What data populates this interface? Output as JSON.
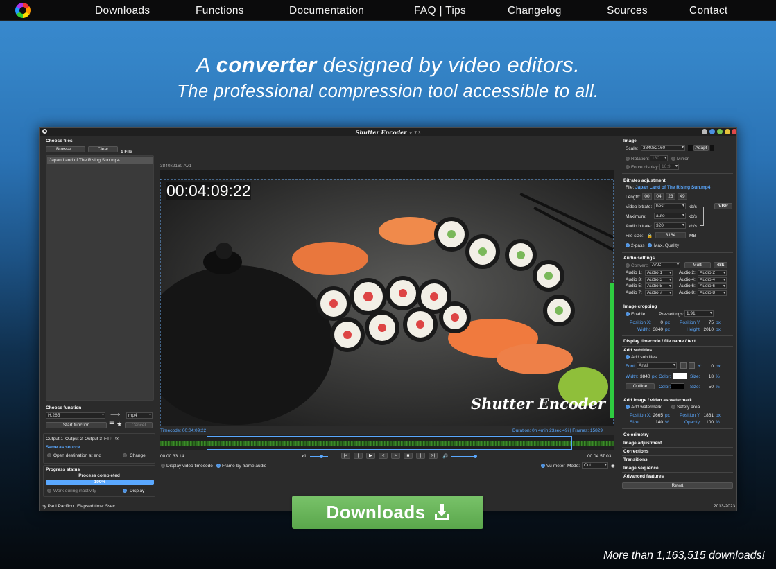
{
  "nav": {
    "items": [
      "Downloads",
      "Functions",
      "Documentation",
      "FAQ | Tips",
      "Changelog",
      "Sources",
      "Contact"
    ]
  },
  "hero": {
    "line1_pre": "A ",
    "line1_bold": "converter",
    "line1_post": " designed by video editors.",
    "line2": "The professional compression tool accessible to all."
  },
  "app": {
    "title": "Shutter Encoder",
    "version": "v17.3",
    "left": {
      "choose_files": "Choose files",
      "browse": "Browse...",
      "clear": "Clear",
      "file_count": "1 File",
      "file_item": "Japan Land of The Rising Sun.mp4",
      "choose_function": "Choose function",
      "codec": "H.265",
      "container": "mp4",
      "start": "Start function",
      "cancel": "Cancel",
      "outputs": [
        "Output 1",
        "Output 2",
        "Output 3",
        "FTP"
      ],
      "same_as_source": "Same as source",
      "open_dest": "Open destination at end",
      "change": "Change",
      "progress_status": "Progress status",
      "process_completed": "Process completed",
      "progress_text": "100%",
      "progress_value": 1.0,
      "work_inactivity": "Work during inactivity",
      "display": "Display",
      "author": "by Paul Pacifico",
      "elapsed": "Elapsed time: 5sec"
    },
    "center": {
      "resolution": "3840x2160 AV1",
      "overlay_tc": "00:04:09:22",
      "watermark": "Shutter Encoder",
      "timecode_label": "Timecode: 00:04:09:22",
      "duration_label": "Duration: 0h 4min 23sec 49i | Frames: 15829",
      "tc_in": "00 00 33 14",
      "tc_out": "00 04 57 03",
      "speed": "x1",
      "transport": [
        "|<",
        "[",
        "▶",
        "<",
        ">",
        "■",
        "]",
        ">|"
      ],
      "display_tc": "Display video timecode",
      "frame_audio": "Frame-by-frame audio",
      "vumeter": "Vu-meter",
      "mode_label": "Mode:",
      "mode": "Cut"
    },
    "right": {
      "image": "Image",
      "scale_label": "Scale:",
      "scale": "3840x2160",
      "adapt": "Adapt",
      "rotation": "Rotation:",
      "rotation_val": "180",
      "mirror": "Mirror",
      "force_display": "Force display:",
      "force_val": "16:9",
      "bitrates": "Bitrates adjustment",
      "file_label": "File:",
      "file": "Japan Land of The Rising Sun.mp4",
      "length_label": "Length:",
      "length": [
        "00",
        "04",
        "23",
        "49"
      ],
      "video_bitrate": "Video bitrate:",
      "video_bitrate_val": "best",
      "maximum": "Maximum:",
      "maximum_val": "auto",
      "audio_bitrate": "Audio bitrate:",
      "audio_bitrate_val": "320",
      "kbs": "kb/s",
      "vbr": "VBR",
      "file_size": "File size:",
      "file_size_val": "3164",
      "mb": "MB",
      "two_pass": "2-pass",
      "max_quality": "Max. Quality",
      "audio_settings": "Audio settings",
      "convert": "Convert:",
      "convert_val": "AAC",
      "multi": "Multi",
      "khz": "48k",
      "audio_rows": [
        [
          "Audio 1:",
          "Audio 1",
          "Audio 2:",
          "Audio 2"
        ],
        [
          "Audio 3:",
          "Audio 3",
          "Audio 4:",
          "Audio 4"
        ],
        [
          "Audio 5:",
          "Audio 5",
          "Audio 6:",
          "Audio 6"
        ],
        [
          "Audio 7:",
          "Audio 7",
          "Audio 8:",
          "Audio 8"
        ]
      ],
      "cropping": "Image cropping",
      "enable": "Enable",
      "presettings": "Pre-settings:",
      "presettings_val": "1.91",
      "pos_x": "Position X:",
      "pos_x_val": "0",
      "pos_y": "Position Y:",
      "pos_y_val": "75",
      "width": "Width:",
      "width_val": "3840",
      "height": "Height:",
      "height_val": "2010",
      "px": "px",
      "display_tc_name": "Display timecode / file name / text",
      "add_subtitles": "Add subtitles",
      "add_subtitles_chk": "Add subtitles",
      "font": "Font:",
      "font_val": "Arial",
      "y_label": "Y:",
      "y_val": "0",
      "sub_width": "Width:",
      "sub_width_val": "3840",
      "color": "Color:",
      "size": "Size:",
      "size_val": "18",
      "pct": "%",
      "outline": "Outline",
      "outline_size_val": "50",
      "watermark_sec": "Add image / video as watermark",
      "add_watermark": "Add watermark",
      "safety_area": "Safety area",
      "wm_pos_x_val": "2665",
      "wm_pos_y_val": "1861",
      "wm_size_val": "140",
      "opacity": "Opacity:",
      "opacity_val": "100",
      "menus": [
        "Colorimetry",
        "Image adjustment",
        "Corrections",
        "Transitions",
        "Image sequence",
        "Advanced features"
      ],
      "reset": "Reset",
      "year": "2013-2023"
    }
  },
  "download_button": "Downloads",
  "footer": "More than 1,163,515 downloads!"
}
